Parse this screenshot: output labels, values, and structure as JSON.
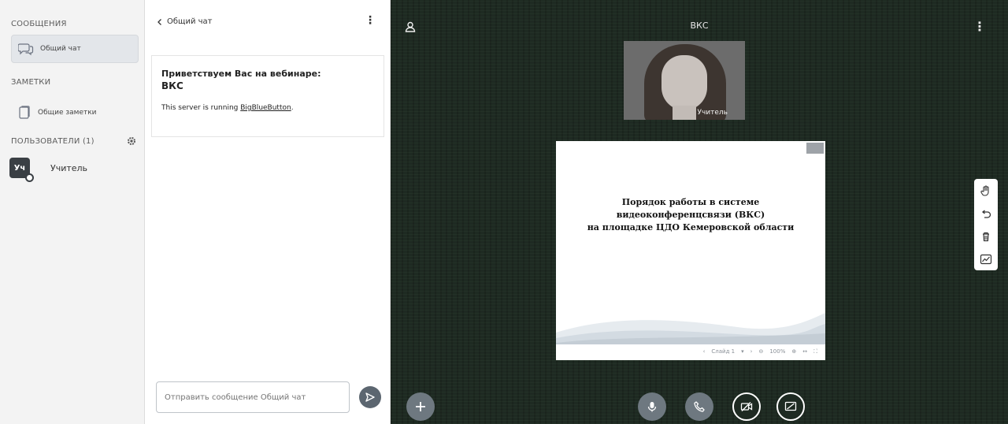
{
  "sidebar": {
    "messages_title": "СООБЩЕНИЯ",
    "public_chat_label": "Общий чат",
    "notes_title": "ЗАМЕТКИ",
    "shared_notes_label": "Общие заметки",
    "users_title": "ПОЛЬЗОВАТЕЛИ (1)",
    "users": [
      {
        "initials": "Уч",
        "name": "Учитель"
      }
    ]
  },
  "chat": {
    "back_label": "Общий чат",
    "welcome_line1": "Приветствуем Вас на вебинаре:",
    "welcome_line2": "ВКС",
    "server_prefix": "This server is running ",
    "server_link": "BigBlueButton",
    "server_suffix": ".",
    "input_placeholder": "Отправить сообщение Общий чат"
  },
  "main": {
    "title": "ВКС",
    "webcam_name": "Учитель",
    "slide": {
      "line1": "Порядок работы в системе",
      "line2": "видеоконференцсвязи (ВКС)",
      "line3": "на площадке ЦДО  Кемеровской области",
      "slide_label": "Слайд 1",
      "zoom": "100%"
    }
  },
  "colors": {
    "main_bg": "#1e2a22",
    "sidebar_bg": "#f3f3f3",
    "send_button": "#5c6670",
    "action_button": "#6e7880"
  }
}
